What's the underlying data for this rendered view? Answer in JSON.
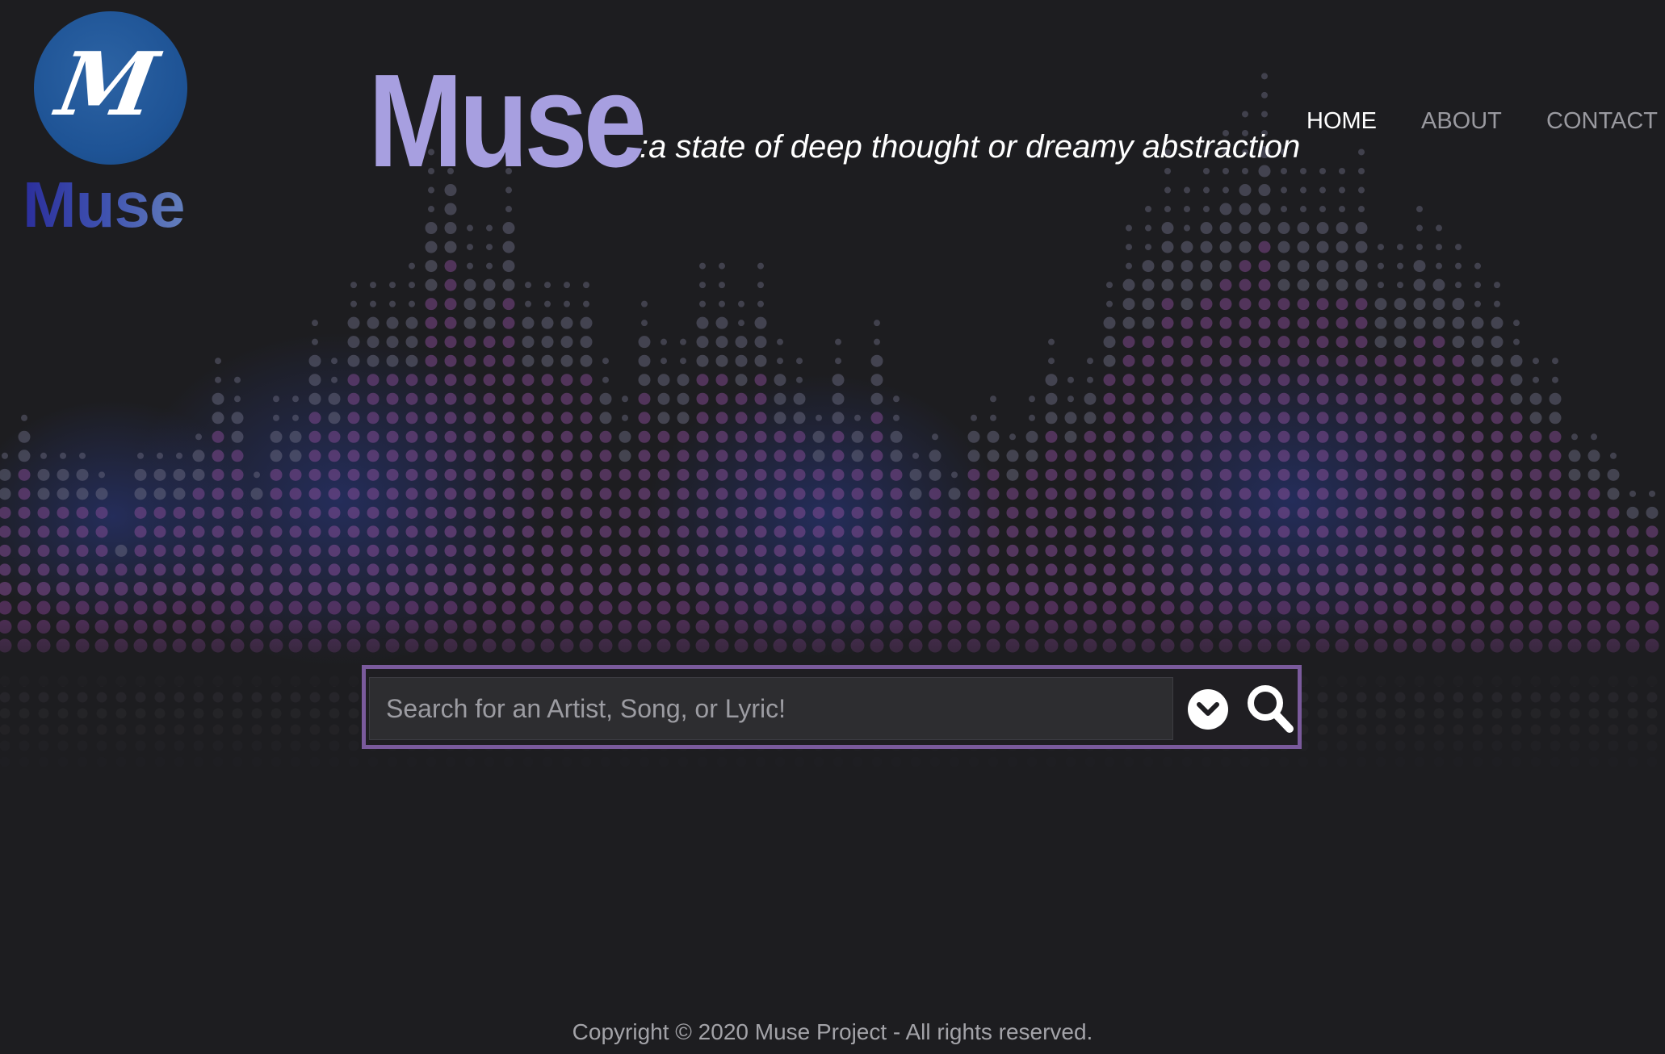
{
  "logo": {
    "glyph": "M",
    "wordmark": "Muse",
    "circle_color": "#1e5395"
  },
  "header": {
    "title": "Muse",
    "tagline": ":a state of deep thought or dreamy abstraction",
    "title_color": "#a79fe0"
  },
  "nav": {
    "items": [
      {
        "label": "HOME",
        "active": true
      },
      {
        "label": "ABOUT",
        "active": false
      },
      {
        "label": "CONTACT",
        "active": false
      }
    ]
  },
  "search": {
    "placeholder": "Search for an Artist, Song, or Lyric!",
    "value": "",
    "border_color": "#7a5a9c",
    "dropdown_icon": "chevron-down-circle-icon",
    "submit_icon": "search-icon"
  },
  "footer": {
    "copyright": "Copyright © 2020 Muse Project - All rights reserved."
  },
  "background": {
    "theme": "equalizer",
    "dot_color": "#8b4f9c",
    "base_color": "#1d1d20"
  }
}
